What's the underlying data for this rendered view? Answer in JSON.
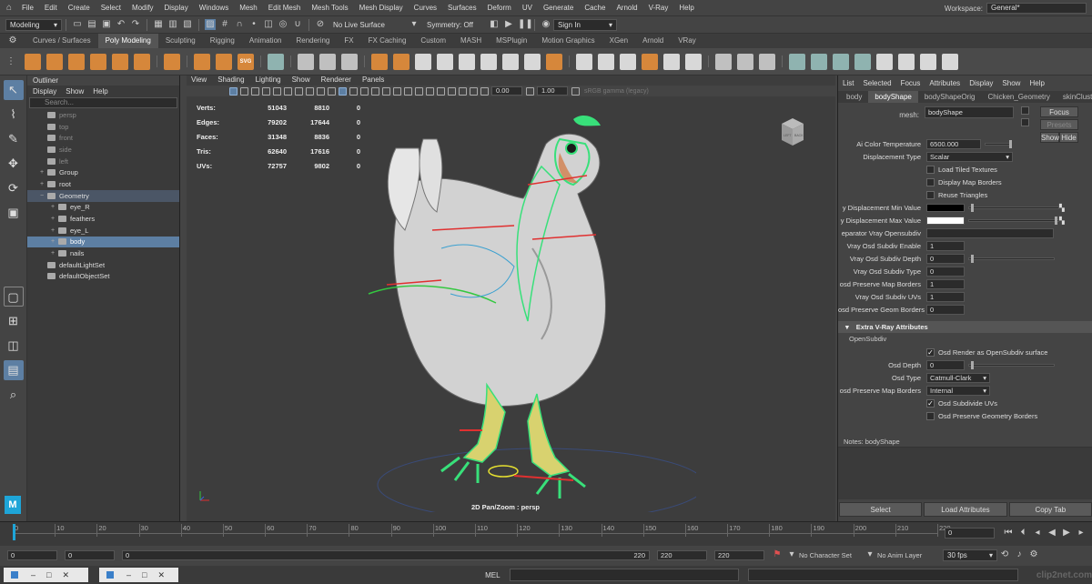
{
  "menubar": {
    "items": [
      "File",
      "Edit",
      "Create",
      "Select",
      "Modify",
      "Display",
      "Windows",
      "Mesh",
      "Edit Mesh",
      "Mesh Tools",
      "Mesh Display",
      "Curves",
      "Surfaces",
      "Deform",
      "UV",
      "Generate",
      "Cache",
      "Arnold",
      "V-Ray",
      "Help"
    ],
    "workspace_label": "Workspace:",
    "workspace_value": "General*"
  },
  "statusline": {
    "menuset": "Modeling",
    "live_surface": "No Live Surface",
    "symmetry": "Symmetry: Off",
    "sign_in": "Sign In"
  },
  "shelf": {
    "tabs": [
      "Curves / Surfaces",
      "Poly Modeling",
      "Sculpting",
      "Rigging",
      "Animation",
      "Rendering",
      "FX",
      "FX Caching",
      "Custom",
      "MASH",
      "MSPlugin",
      "Motion Graphics",
      "XGen",
      "Arnold",
      "VRay"
    ],
    "active_tab": "Poly Modeling",
    "svg_label": "SVG"
  },
  "outliner": {
    "title": "Outliner",
    "menu": [
      "Display",
      "Show",
      "Help"
    ],
    "search_placeholder": "Search...",
    "items": [
      {
        "label": "persp",
        "indent": 1,
        "dim": true,
        "expand": ""
      },
      {
        "label": "top",
        "indent": 1,
        "dim": true,
        "expand": ""
      },
      {
        "label": "front",
        "indent": 1,
        "dim": true,
        "expand": ""
      },
      {
        "label": "side",
        "indent": 1,
        "dim": true,
        "expand": ""
      },
      {
        "label": "left",
        "indent": 1,
        "dim": true,
        "expand": ""
      },
      {
        "label": "Group",
        "indent": 1,
        "dim": false,
        "expand": "+"
      },
      {
        "label": "root",
        "indent": 1,
        "dim": false,
        "expand": "+"
      },
      {
        "label": "Geometry",
        "indent": 1,
        "dim": false,
        "expand": "−",
        "state": "hl"
      },
      {
        "label": "eye_R",
        "indent": 2,
        "dim": false,
        "expand": "+"
      },
      {
        "label": "feathers",
        "indent": 2,
        "dim": false,
        "expand": "+"
      },
      {
        "label": "eye_L",
        "indent": 2,
        "dim": false,
        "expand": "+"
      },
      {
        "label": "body",
        "indent": 2,
        "dim": false,
        "expand": "+",
        "state": "selected"
      },
      {
        "label": "nails",
        "indent": 2,
        "dim": false,
        "expand": "+"
      },
      {
        "label": "defaultLightSet",
        "indent": 1,
        "dim": false,
        "expand": ""
      },
      {
        "label": "defaultObjectSet",
        "indent": 1,
        "dim": false,
        "expand": ""
      }
    ]
  },
  "viewport": {
    "menu": [
      "View",
      "Shading",
      "Lighting",
      "Show",
      "Renderer",
      "Panels"
    ],
    "field1": "0.00",
    "field2": "1.00",
    "colorspace": "sRGB gamma (legacy)",
    "hud": [
      {
        "label": "Verts:",
        "a": "51043",
        "b": "8810",
        "c": "0"
      },
      {
        "label": "Edges:",
        "a": "79202",
        "b": "17644",
        "c": "0"
      },
      {
        "label": "Faces:",
        "a": "31348",
        "b": "8836",
        "c": "0"
      },
      {
        "label": "Tris:",
        "a": "62640",
        "b": "17616",
        "c": "0"
      },
      {
        "label": "UVs:",
        "a": "72757",
        "b": "9802",
        "c": "0"
      }
    ],
    "camera_label": "2D Pan/Zoom : persp",
    "viewcube_left": "LEFT",
    "viewcube_back": "BACK"
  },
  "attribute_editor": {
    "menu": [
      "List",
      "Selected",
      "Focus",
      "Attributes",
      "Display",
      "Show",
      "Help"
    ],
    "tabs": [
      "body",
      "bodyShape",
      "bodyShapeOrig",
      "Chicken_Geometry",
      "skinCluste"
    ],
    "active_tab": "bodyShape",
    "mesh_label": "mesh:",
    "mesh_value": "bodyShape",
    "focus_btn": "Focus",
    "presets_btn": "Presets",
    "show_btn": "Show",
    "hide_btn": "Hide",
    "rows": [
      {
        "label": "Ai Color Temperature",
        "value": "6500.000",
        "type": "slider"
      },
      {
        "label": "Displacement Type",
        "value": "Scalar",
        "type": "dropdown"
      },
      {
        "label": "",
        "value": "Load Tiled Textures",
        "type": "check",
        "checked": false
      },
      {
        "label": "",
        "value": "Display Map Borders",
        "type": "check",
        "checked": false
      },
      {
        "label": "",
        "value": "Reuse Triangles",
        "type": "check",
        "checked": false
      },
      {
        "label": "y Displacement Min Value",
        "value": "",
        "type": "color-black"
      },
      {
        "label": "y Displacement Max Value",
        "value": "",
        "type": "color-white"
      },
      {
        "label": "eparator Vray Opensubdiv",
        "value": "",
        "type": "bar"
      },
      {
        "label": "Vray Osd Subdiv Enable",
        "value": "1",
        "type": "field"
      },
      {
        "label": "Vray Osd Subdiv Depth",
        "value": "0",
        "type": "slider-short"
      },
      {
        "label": "Vray Osd Subdiv Type",
        "value": "0",
        "type": "field"
      },
      {
        "label": "osd Preserve Map Borders",
        "value": "1",
        "type": "field"
      },
      {
        "label": "Vray Osd Subdiv UVs",
        "value": "1",
        "type": "field"
      },
      {
        "label": "osd Preserve Geom Borders",
        "value": "0",
        "type": "field"
      }
    ],
    "section_title": "Extra V-Ray Attributes",
    "sub_section": "OpenSubdiv",
    "osd_rows": [
      {
        "label": "",
        "value": "Osd Render as OpenSubdiv surface",
        "type": "check",
        "checked": true
      },
      {
        "label": "Osd Depth",
        "value": "0",
        "type": "slider-short"
      },
      {
        "label": "Osd Type",
        "value": "Catmull-Clark",
        "type": "dropdown"
      },
      {
        "label": "osd Preserve Map Borders",
        "value": "Internal",
        "type": "dropdown"
      },
      {
        "label": "",
        "value": "Osd Subdivide UVs",
        "type": "check",
        "checked": true
      },
      {
        "label": "",
        "value": "Osd Preserve Geometry Borders",
        "type": "check",
        "checked": false
      }
    ],
    "notes_label": "Notes:  bodyShape",
    "buttons": [
      "Select",
      "Load Attributes",
      "Copy Tab"
    ]
  },
  "timeline": {
    "ticks": [
      "0",
      "10",
      "20",
      "30",
      "40",
      "50",
      "60",
      "70",
      "80",
      "90",
      "100",
      "110",
      "120",
      "130",
      "140",
      "150",
      "160",
      "170",
      "180",
      "190",
      "200",
      "210",
      "220"
    ],
    "current_frame": "0"
  },
  "range": {
    "start": "0",
    "start2": "0",
    "range_start": "0",
    "range_end": "220",
    "end": "220",
    "end2": "220",
    "character_set": "No Character Set",
    "anim_layer": "No Anim Layer",
    "fps": "30 fps"
  },
  "cmdline": {
    "mel_label": "MEL",
    "watermark": "clip2net.com"
  },
  "colors": {
    "selection": "#5d7fa3",
    "shelf_orange": "#d6873b",
    "wireframe_green": "#38e07a"
  }
}
